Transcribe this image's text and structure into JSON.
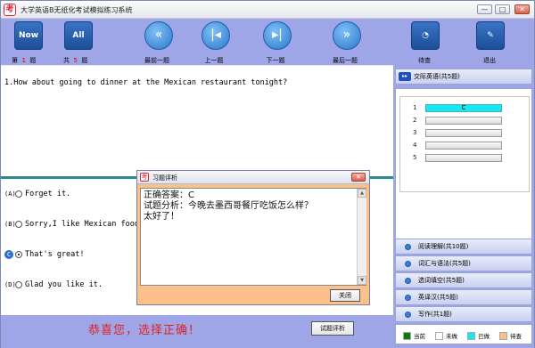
{
  "window": {
    "title": "大学英语B无纸化考试模拟练习系统",
    "logo_char": "考",
    "minimize": "—",
    "maximize": "□",
    "close": "✕"
  },
  "toolbar": {
    "now_icon": "Now",
    "all_icon": "All",
    "first_label": "最前一题",
    "prev_label": "上一题",
    "next_label": "下一题",
    "last_label": "最后一题",
    "pause_label": "待查",
    "exit_label": "退出",
    "current_prefix": "第",
    "current_num": "1",
    "current_suffix": "题",
    "total_prefix": "共",
    "total_num": "5",
    "total_suffix": "题"
  },
  "question": {
    "text": "1.How about going to dinner at the Mexican restaurant tonight?"
  },
  "options": [
    {
      "letter": "A",
      "text": "Forget it.",
      "selected": false
    },
    {
      "letter": "B",
      "text": "Sorry,I like Mexican food.",
      "selected": false
    },
    {
      "letter": "C",
      "text": "That's great!",
      "selected": true
    },
    {
      "letter": "D",
      "text": "Glad you like it.",
      "selected": false
    }
  ],
  "bottom": {
    "feedback": "恭喜您，选择正确！",
    "eval_button": "试题评析"
  },
  "dialog": {
    "title": "习题评析",
    "body_line1": "正确答案：C",
    "body_line2": "试题分析：今晚去墨西哥餐厅吃饭怎么样？",
    "body_line3": "太好了！",
    "close_button": "关闭"
  },
  "right_panel": {
    "current_section": "交际英语(共5题)",
    "rows": [
      {
        "num": "1",
        "answer": "C",
        "status": "done"
      },
      {
        "num": "2",
        "answer": "",
        "status": "unanswered"
      },
      {
        "num": "3",
        "answer": "",
        "status": "unanswered"
      },
      {
        "num": "4",
        "answer": "",
        "status": "unanswered"
      },
      {
        "num": "5",
        "answer": "",
        "status": "unanswered"
      }
    ],
    "sections": [
      "阅读理解(共10题)",
      "词汇与语法(共5题)",
      "选词填空(共5题)",
      "英译汉(共5题)",
      "写作(共1题)"
    ],
    "legend": {
      "current": "当前",
      "unanswered": "未做",
      "answered": "已做",
      "pending": "待查"
    }
  },
  "colors": {
    "toolbar_bg": "#9fa6e8",
    "divider": "#2b8a8e",
    "done": "#14e8f4",
    "legend_current": "#0a7a0a",
    "legend_unanswered": "#ffffff",
    "legend_answered": "#14e8f4",
    "legend_pending": "#f7c08a",
    "feedback": "#e02020",
    "dialog_bg": "#fcc08c"
  }
}
